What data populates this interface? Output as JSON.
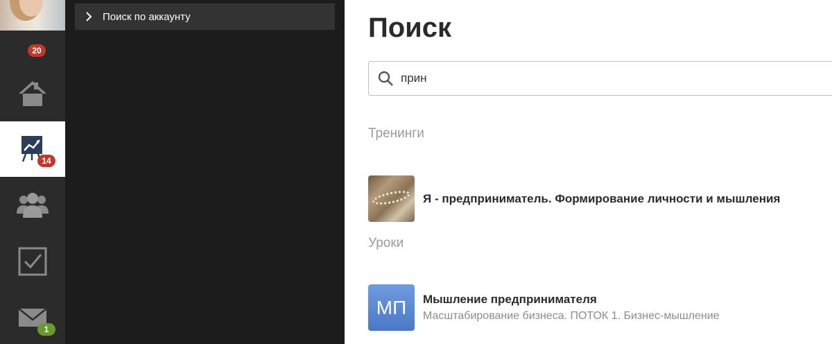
{
  "rail": {
    "notifications_count": "20",
    "items": [
      {
        "icon": "home-icon",
        "badge": ""
      },
      {
        "icon": "chart-board-icon",
        "badge": "14",
        "active": true
      },
      {
        "icon": "users-icon",
        "badge": ""
      },
      {
        "icon": "checkbox-icon",
        "badge": ""
      },
      {
        "icon": "mail-icon",
        "badge": "1"
      }
    ]
  },
  "panel": {
    "items": [
      {
        "label": "Поиск по аккаунту",
        "icon": "chevron-right-icon"
      }
    ]
  },
  "main": {
    "title": "Поиск",
    "search": {
      "value": "прин",
      "icon": "search-icon"
    },
    "sections": [
      {
        "heading": "Тренинги",
        "results": [
          {
            "title": "Я - предприниматель. Формирование личности и мышления",
            "subtitle": ""
          }
        ]
      },
      {
        "heading": "Уроки",
        "results": [
          {
            "thumb_text": "МП",
            "title": "Мышление предпринимателя",
            "subtitle": "Масштабирование бизнеса. ПОТОК 1. Бизнес-мышление"
          }
        ]
      }
    ]
  },
  "colors": {
    "rail_bg": "#2b2b2b",
    "panel_bg": "#1c1c1c",
    "badge_red": "#c0392b",
    "badge_green": "#6a9a2e",
    "icon_gray": "#8a8a8a",
    "active_icon": "#2c3e57"
  }
}
